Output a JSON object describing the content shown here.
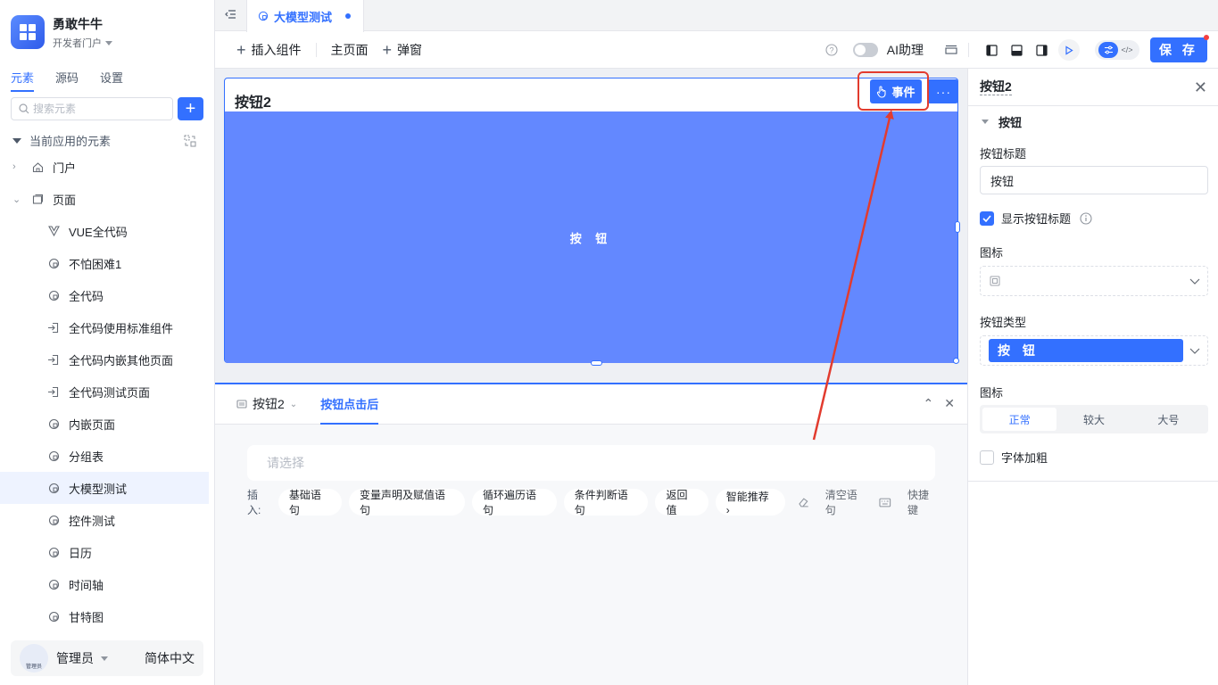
{
  "app": {
    "name": "勇敢牛牛",
    "subtitle": "开发者门户"
  },
  "sidebar": {
    "tabs": [
      {
        "label": "元素",
        "active": true
      },
      {
        "label": "源码",
        "active": false
      },
      {
        "label": "设置",
        "active": false
      }
    ],
    "search_placeholder": "搜索元素",
    "section_label": "当前应用的元素",
    "tree": [
      {
        "label": "门户",
        "icon": "home-icon",
        "level": 0,
        "expanded": false
      },
      {
        "label": "页面",
        "icon": "pages-icon",
        "level": 0,
        "expanded": true
      },
      {
        "label": "VUE全代码",
        "icon": "vue-icon",
        "level": 1
      },
      {
        "label": "不怕困难1",
        "icon": "page-icon",
        "level": 1
      },
      {
        "label": "全代码",
        "icon": "page-icon",
        "level": 1
      },
      {
        "label": "全代码使用标准组件",
        "icon": "redirect-icon",
        "level": 1
      },
      {
        "label": "全代码内嵌其他页面",
        "icon": "redirect-icon",
        "level": 1
      },
      {
        "label": "全代码测试页面",
        "icon": "redirect-icon",
        "level": 1
      },
      {
        "label": "内嵌页面",
        "icon": "page-icon",
        "level": 1
      },
      {
        "label": "分组表",
        "icon": "page-icon",
        "level": 1
      },
      {
        "label": "大模型测试",
        "icon": "page-icon",
        "level": 1,
        "active": true
      },
      {
        "label": "控件测试",
        "icon": "page-icon",
        "level": 1
      },
      {
        "label": "日历",
        "icon": "page-icon",
        "level": 1
      },
      {
        "label": "时间轴",
        "icon": "page-icon",
        "level": 1
      },
      {
        "label": "甘特图",
        "icon": "page-icon",
        "level": 1
      }
    ],
    "user": {
      "name": "管理员",
      "avatar_text": "管理员",
      "language": "简体中文"
    }
  },
  "tabbar": {
    "active_tab": "大模型测试"
  },
  "toolbar": {
    "insert_component": "插入组件",
    "main_page": "主页面",
    "popup": "弹窗",
    "ai_assistant": "AI助理",
    "save": "保 存"
  },
  "canvas": {
    "widget_title": "按钮2",
    "button_text": "按 钮",
    "event_button": "事件",
    "more_button": "···"
  },
  "event_panel": {
    "component_name": "按钮2",
    "active_tab": "按钮点击后",
    "select_placeholder": "请选择",
    "insert_label": "插入:",
    "chips": [
      "基础语句",
      "变量声明及赋值语句",
      "循环遍历语句",
      "条件判断语句",
      "返回值",
      "智能推荐 ›"
    ],
    "clear": "清空语句",
    "shortcuts": "快捷键"
  },
  "props": {
    "title": "按钮2",
    "section": "按钮",
    "button_title_label": "按钮标题",
    "button_title_value": "按钮",
    "show_title_label": "显示按钮标题",
    "show_title_checked": true,
    "icon_label": "图标",
    "button_type_label": "按钮类型",
    "button_type_value": "按 钮",
    "size_label": "图标",
    "sizes": [
      {
        "label": "正常",
        "selected": true
      },
      {
        "label": "较大",
        "selected": false
      },
      {
        "label": "大号",
        "selected": false
      }
    ],
    "bold_label": "字体加粗",
    "bold_checked": false
  },
  "colors": {
    "accent": "#3370ff",
    "button_fill": "#6388ff",
    "annotation": "#e23b2e"
  }
}
